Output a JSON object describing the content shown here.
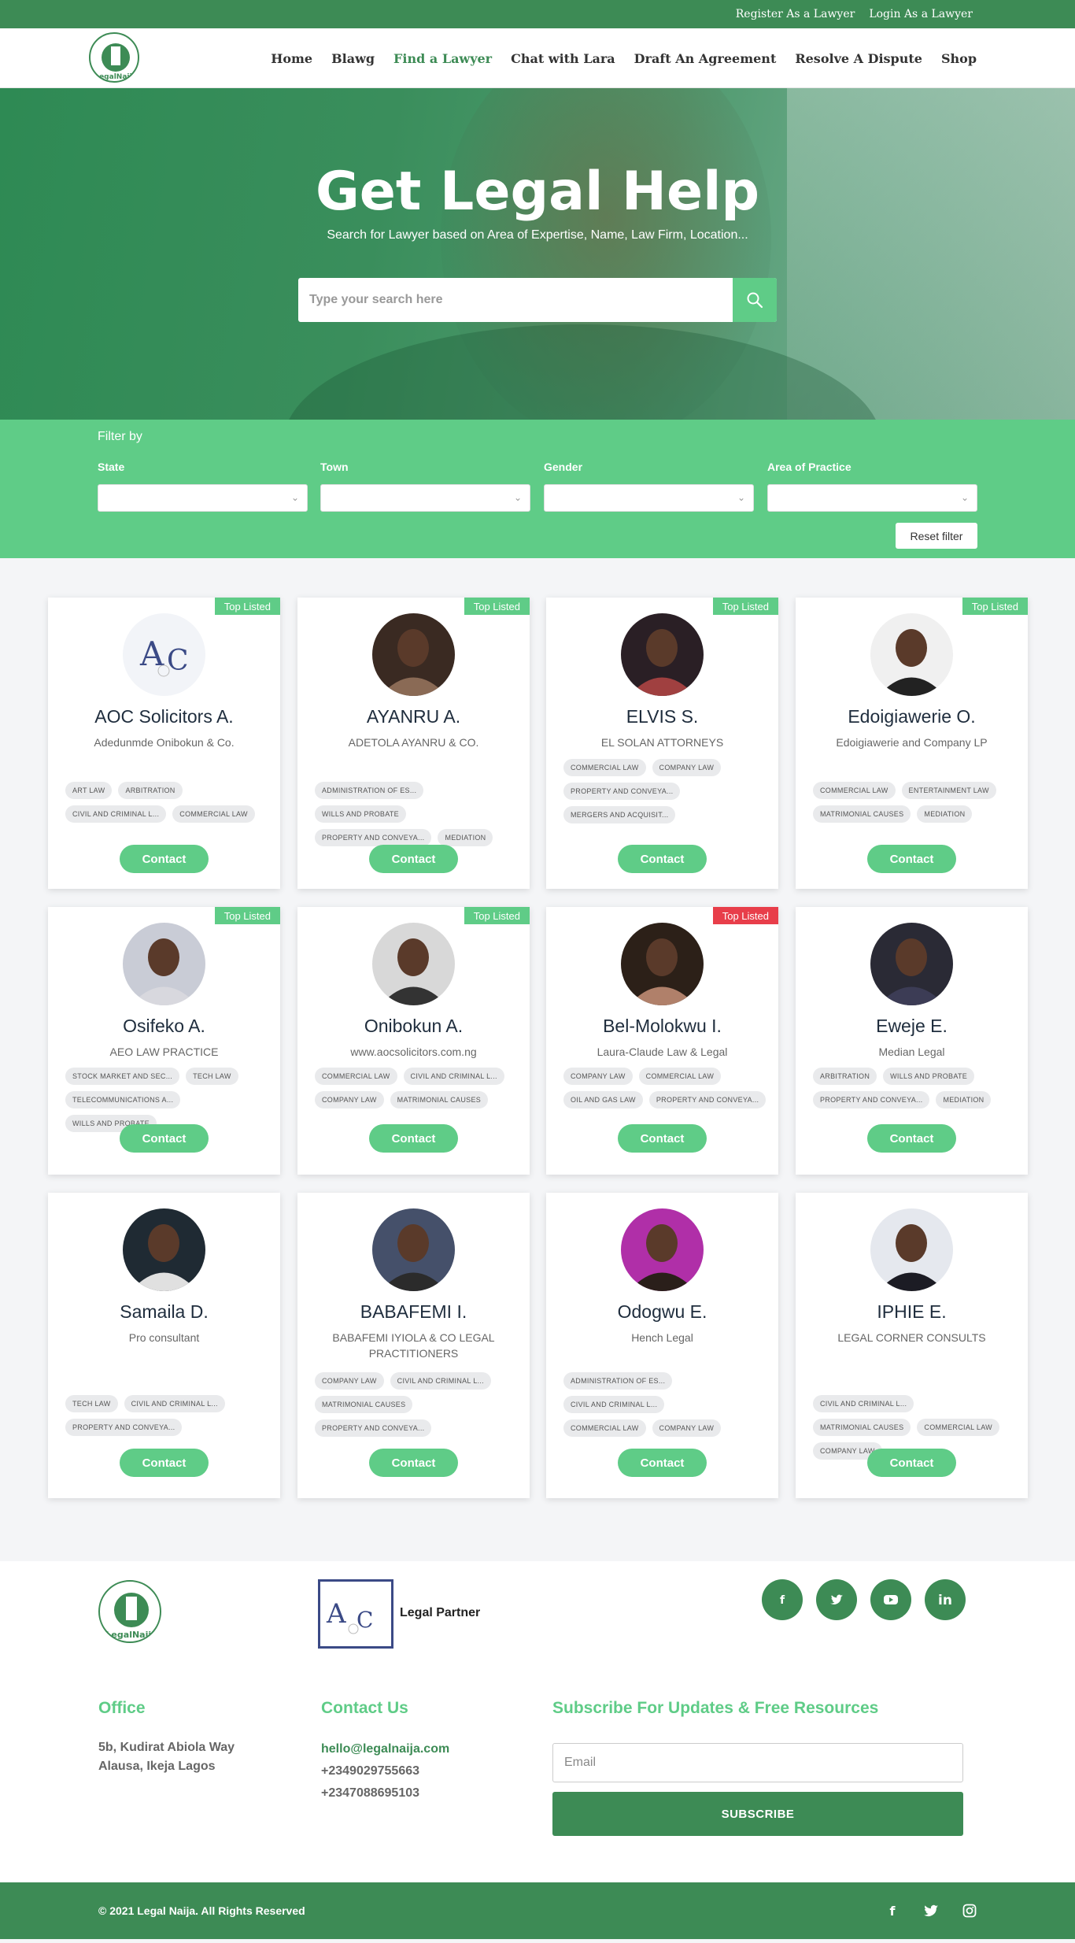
{
  "topbar": {
    "register": "Register As a Lawyer",
    "login": "Login As a Lawyer"
  },
  "nav": {
    "logo_text": "LegalNaija",
    "items": [
      "Home",
      "Blawg",
      "Find a Lawyer",
      "Chat with Lara",
      "Draft An Agreement",
      "Resolve A Dispute",
      "Shop"
    ],
    "active": "Find a Lawyer"
  },
  "hero": {
    "title": "Get Legal Help",
    "subtitle": "Search for Lawyer based on Area of Expertise, Name, Law Firm, Location...",
    "search_placeholder": "Type your search here"
  },
  "filter": {
    "title": "Filter by",
    "labels": [
      "State",
      "Town",
      "Gender",
      "Area of Practice"
    ],
    "reset": "Reset filter"
  },
  "cards": [
    {
      "name": "AOC Solicitors A.",
      "firm": "Adedunmde Onibokun & Co.",
      "badge": "Top Listed",
      "badge_color": "#5fcc87",
      "tags": [
        "ART LAW",
        "ARBITRATION",
        "CIVIL AND CRIMINAL L...",
        "COMMERCIAL LAW"
      ],
      "contact": "Contact"
    },
    {
      "name": "AYANRU A.",
      "firm": "ADETOLA AYANRU & CO.",
      "badge": "Top Listed",
      "badge_color": "#5fcc87",
      "tags": [
        "ADMINISTRATION OF ES...",
        "WILLS AND PROBATE",
        "PROPERTY AND CONVEYA...",
        "MEDIATION"
      ],
      "contact": "Contact"
    },
    {
      "name": "ELVIS S.",
      "firm": "EL SOLAN ATTORNEYS",
      "badge": "Top Listed",
      "badge_color": "#5fcc87",
      "tags": [
        "COMMERCIAL LAW",
        "COMPANY LAW",
        "PROPERTY AND CONVEYA...",
        "MERGERS AND ACQUISIT..."
      ],
      "contact": "Contact"
    },
    {
      "name": "Edoigiawerie O.",
      "firm": "Edoigiawerie and Company LP",
      "badge": "Top Listed",
      "badge_color": "#5fcc87",
      "tags": [
        "COMMERCIAL LAW",
        "ENTERTAINMENT LAW",
        "MATRIMONIAL CAUSES",
        "MEDIATION"
      ],
      "contact": "Contact"
    },
    {
      "name": "Osifeko A.",
      "firm": "AEO LAW PRACTICE",
      "badge": "Top Listed",
      "badge_color": "#5fcc87",
      "tags": [
        "STOCK MARKET AND SEC...",
        "TECH LAW",
        "TELECOMMUNICATIONS A...",
        "WILLS AND PROBATE"
      ],
      "contact": "Contact"
    },
    {
      "name": "Onibokun A.",
      "firm": "www.aocsolicitors.com.ng",
      "badge": "Top Listed",
      "badge_color": "#5fcc87",
      "tags": [
        "COMMERCIAL LAW",
        "CIVIL AND CRIMINAL L...",
        "COMPANY LAW",
        "MATRIMONIAL CAUSES"
      ],
      "contact": "Contact"
    },
    {
      "name": "Bel-Molokwu I.",
      "firm": "Laura-Claude Law & Legal",
      "badge": "Top Listed",
      "badge_color": "#e83e4a",
      "tags": [
        "COMPANY LAW",
        "COMMERCIAL LAW",
        "OIL AND GAS LAW",
        "PROPERTY AND CONVEYA..."
      ],
      "contact": "Contact"
    },
    {
      "name": "Eweje E.",
      "firm": "Median Legal",
      "badge": "",
      "badge_color": "",
      "tags": [
        "ARBITRATION",
        "WILLS AND PROBATE",
        "PROPERTY AND CONVEYA...",
        "MEDIATION"
      ],
      "contact": "Contact"
    },
    {
      "name": "Samaila D.",
      "firm": "Pro consultant",
      "badge": "",
      "badge_color": "",
      "tags": [
        "TECH LAW",
        "CIVIL AND CRIMINAL L...",
        "PROPERTY AND CONVEYA..."
      ],
      "contact": "Contact"
    },
    {
      "name": "BABAFEMI I.",
      "firm": "BABAFEMI IYIOLA & CO LEGAL PRACTITIONERS",
      "badge": "",
      "badge_color": "",
      "tags": [
        "COMPANY LAW",
        "CIVIL AND CRIMINAL L...",
        "MATRIMONIAL CAUSES",
        "PROPERTY AND CONVEYA..."
      ],
      "contact": "Contact"
    },
    {
      "name": "Odogwu E.",
      "firm": "Hench Legal",
      "badge": "",
      "badge_color": "",
      "tags": [
        "ADMINISTRATION OF ES...",
        "CIVIL AND CRIMINAL L...",
        "COMMERCIAL LAW",
        "COMPANY LAW"
      ],
      "contact": "Contact"
    },
    {
      "name": "IPHIE E.",
      "firm": "LEGAL CORNER CONSULTS",
      "badge": "",
      "badge_color": "",
      "tags": [
        "CIVIL AND CRIMINAL L...",
        "MATRIMONIAL CAUSES",
        "COMMERCIAL LAW",
        "COMPANY LAW"
      ],
      "contact": "Contact"
    }
  ],
  "footer": {
    "partner_label": "Legal Partner",
    "social_icons": [
      "facebook-icon",
      "twitter-icon",
      "youtube-icon",
      "linkedin-icon"
    ],
    "office_heading": "Office",
    "office_address": "5b, Kudirat Abiola Way Alausa, Ikeja Lagos",
    "contact_heading": "Contact Us",
    "email": "hello@legalnaija.com",
    "phone1": "+2349029755663",
    "phone2": "+2347088695103",
    "subscribe_heading": "Subscribe For Updates & Free Resources",
    "email_placeholder": "Email",
    "subscribe_button": "SUBSCRIBE",
    "copyright": "© 2021 Legal Naija. All Rights Reserved"
  },
  "colors": {
    "primary": "#3d8b55",
    "accent": "#5fcc87",
    "alert": "#e83e4a"
  }
}
